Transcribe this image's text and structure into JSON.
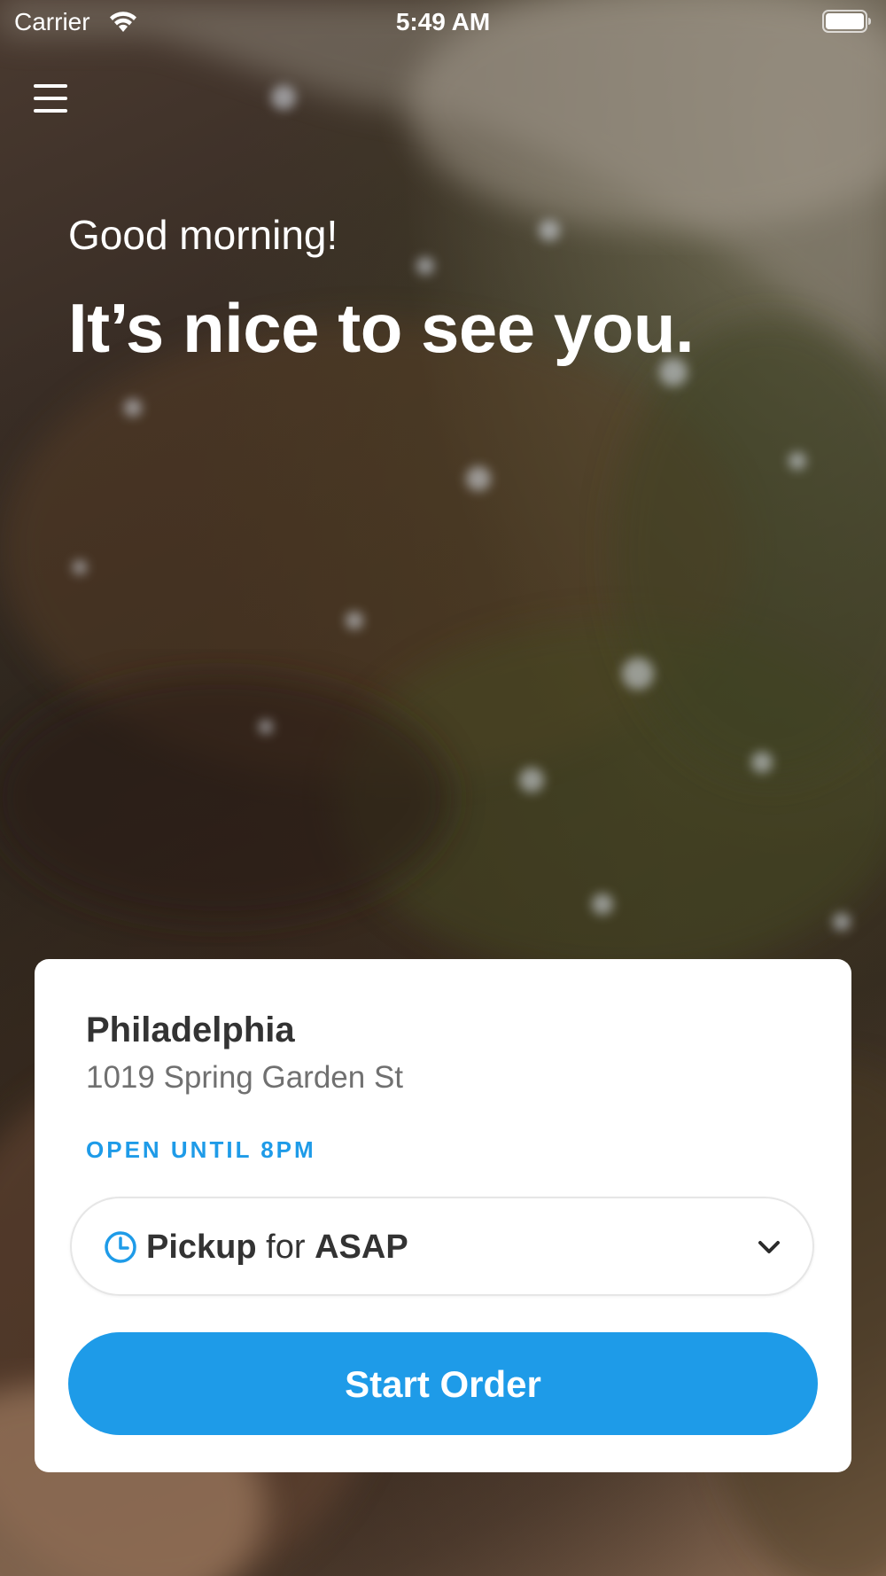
{
  "status_bar": {
    "carrier": "Carrier",
    "time": "5:49 AM",
    "wifi_icon": "wifi-icon",
    "battery_icon": "battery-full-icon"
  },
  "header": {
    "menu_icon": "hamburger-menu-icon",
    "greeting": "Good morning!",
    "headline": "It’s nice to see you."
  },
  "location_card": {
    "city": "Philadelphia",
    "address": "1019 Spring Garden St",
    "hours": "OPEN UNTIL 8PM",
    "order_mode": {
      "icon": "clock-icon",
      "mode": "Pickup",
      "connector": "for",
      "time": "ASAP",
      "dropdown_icon": "chevron-down-icon"
    },
    "start_button_label": "Start Order"
  },
  "colors": {
    "accent": "#1e9be8",
    "card_background": "#ffffff",
    "city_text": "#333333",
    "address_text": "#707070"
  }
}
